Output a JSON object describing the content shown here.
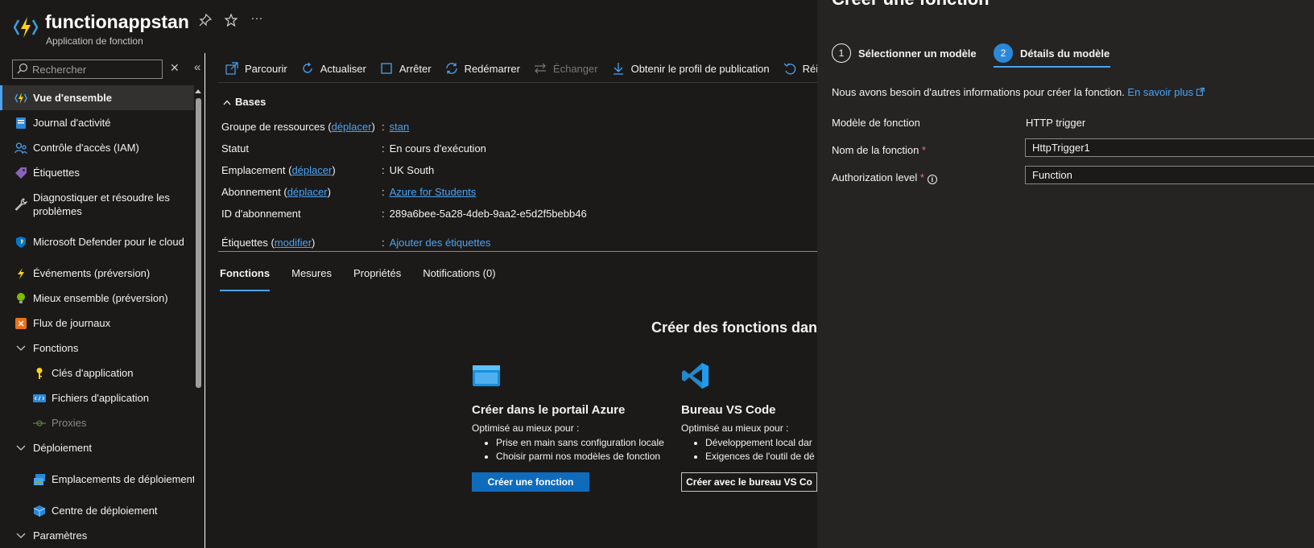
{
  "header": {
    "title": "functionappstan",
    "subtitle": "Application de fonction",
    "pin_icon": "pin-icon",
    "favorite_icon": "star-icon",
    "more_label": "···"
  },
  "sidebar": {
    "search": {
      "placeholder": "Rechercher"
    },
    "collapse_label": "«",
    "clear_label": "✕",
    "items": [
      {
        "label": "Vue d'ensemble",
        "icon": "function-app-icon",
        "active": true
      },
      {
        "label": "Journal d'activité",
        "icon": "activity-log-icon"
      },
      {
        "label": "Contrôle d'accès (IAM)",
        "icon": "access-control-icon"
      },
      {
        "label": "Étiquettes",
        "icon": "tag-icon"
      },
      {
        "label": "Diagnostiquer et résoudre les problèmes",
        "icon": "wrench-icon"
      },
      {
        "label": "Microsoft Defender pour le cloud",
        "icon": "shield-icon"
      },
      {
        "label": "Événements (préversion)",
        "icon": "lightning-icon"
      },
      {
        "label": "Mieux ensemble (préversion)",
        "icon": "lightbulb-icon"
      },
      {
        "label": "Flux de journaux",
        "icon": "log-stream-icon"
      },
      {
        "label": "Fonctions",
        "icon": "chevron-down-icon",
        "group": true
      },
      {
        "label": "Clés d'application",
        "icon": "key-icon"
      },
      {
        "label": "Fichiers d'application",
        "icon": "app-files-icon"
      },
      {
        "label": "Proxies",
        "icon": "proxy-icon",
        "disabled": true
      },
      {
        "label": "Déploiement",
        "icon": "chevron-down-icon",
        "group": true
      },
      {
        "label": "Emplacements de déploiement",
        "icon": "deployment-slots-icon"
      },
      {
        "label": "Centre de déploiement",
        "icon": "deployment-center-icon"
      },
      {
        "label": "Paramètres",
        "icon": "chevron-down-icon",
        "group": true
      }
    ]
  },
  "toolbar": {
    "items": [
      {
        "label": "Parcourir",
        "icon": "browse-icon"
      },
      {
        "label": "Actualiser",
        "icon": "refresh-icon"
      },
      {
        "label": "Arrêter",
        "icon": "stop-icon"
      },
      {
        "label": "Redémarrer",
        "icon": "restart-icon"
      },
      {
        "label": "Échanger",
        "icon": "swap-icon",
        "disabled": true
      },
      {
        "label": "Obtenir le profil de publication",
        "icon": "download-icon"
      },
      {
        "label": "Réinitialiser",
        "icon": "reset-icon"
      }
    ]
  },
  "bases": {
    "heading": "Bases",
    "rows": [
      {
        "label": "Groupe de ressources",
        "link": "déplacer",
        "value": "stan",
        "value_link": true
      },
      {
        "label": "Statut",
        "value": "En cours d'exécution"
      },
      {
        "label": "Emplacement",
        "link": "déplacer",
        "value": "UK South"
      },
      {
        "label": "Abonnement",
        "link": "déplacer",
        "value": "Azure for Students",
        "value_link": true
      },
      {
        "label": "ID d'abonnement",
        "value": "289a6bee-5a28-4deb-9aa2-e5d2f5bebb46"
      },
      {
        "label": "Étiquettes",
        "link": "modifier",
        "value": "Ajouter des étiquettes",
        "value_plain_link": true
      }
    ]
  },
  "tabs": [
    {
      "label": "Fonctions",
      "active": true
    },
    {
      "label": "Mesures"
    },
    {
      "label": "Propriétés"
    },
    {
      "label": "Notifications (0)"
    }
  ],
  "create": {
    "heading": "Créer des fonctions dan",
    "cards": [
      {
        "title": "Créer dans le portail Azure",
        "subtitle": "Optimisé au mieux pour :",
        "bullets": [
          "Prise en main sans configuration locale",
          "Choisir parmi nos modèles de fonction"
        ],
        "button": "Créer une fonction",
        "icon": "portal-window-icon"
      },
      {
        "title": "Bureau VS Code",
        "subtitle": "Optimisé au mieux pour :",
        "bullets": [
          "Développement local dar",
          "Exigences de l'outil de dé"
        ],
        "button": "Créer avec le bureau VS Co",
        "icon": "vscode-icon"
      }
    ]
  },
  "panel": {
    "title": "Créer une fonction",
    "steps": [
      {
        "number": "1",
        "label": "Sélectionner un modèle"
      },
      {
        "number": "2",
        "label": "Détails du modèle",
        "active": true
      }
    ],
    "info_text": "Nous avons besoin d'autres informations pour créer la fonction.",
    "learn_more": "En savoir plus",
    "fields": {
      "template_label": "Modèle de fonction",
      "template_value": "HTTP trigger",
      "name_label": "Nom de la fonction",
      "name_value": "HttpTrigger1",
      "auth_label": "Authorization level",
      "auth_value": "Function",
      "required_mark": "*",
      "info_glyph": "i"
    }
  },
  "colors": {
    "accent": "#4aa3f5",
    "primary_button": "#0f6cbd",
    "background": "#1b1a19",
    "panel_background": "#252423"
  }
}
